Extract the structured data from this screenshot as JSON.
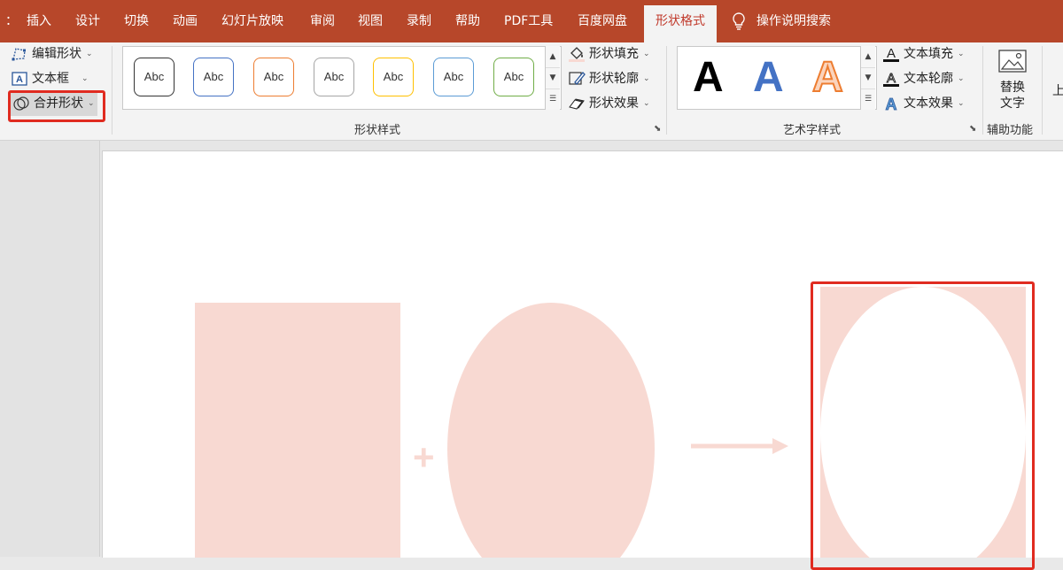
{
  "menubar": {
    "tabs": [
      {
        "label": "插入"
      },
      {
        "label": "设计"
      },
      {
        "label": "切换"
      },
      {
        "label": "动画"
      },
      {
        "label": "幻灯片放映"
      },
      {
        "label": "审阅"
      },
      {
        "label": "视图"
      },
      {
        "label": "录制"
      },
      {
        "label": "帮助"
      },
      {
        "label": "PDF工具"
      },
      {
        "label": "百度网盘"
      },
      {
        "label": "形状格式"
      }
    ],
    "active_tab": "形状格式",
    "search_label": "操作说明搜索"
  },
  "insert_shapes": {
    "edit_shape": "编辑形状",
    "text_box": "文本框",
    "merge_shapes": "合并形状"
  },
  "shape_styles": {
    "preview_label": "Abc",
    "fill": "形状填充",
    "outline": "形状轮廓",
    "effects": "形状效果",
    "group_label": "形状样式"
  },
  "wordart_styles": {
    "letter": "A",
    "text_fill": "文本填充",
    "text_outline": "文本轮廓",
    "text_effects": "文本效果",
    "group_label": "艺术字样式"
  },
  "accessibility": {
    "alt_text_line1": "替换",
    "alt_text_line2": "文字",
    "group_label": "辅助功能",
    "partial": "上"
  },
  "slide": {
    "plus": "+"
  },
  "colors": {
    "accent": "#b7472a",
    "shape_fill": "#f8d9d2",
    "highlight": "#e02b20"
  }
}
